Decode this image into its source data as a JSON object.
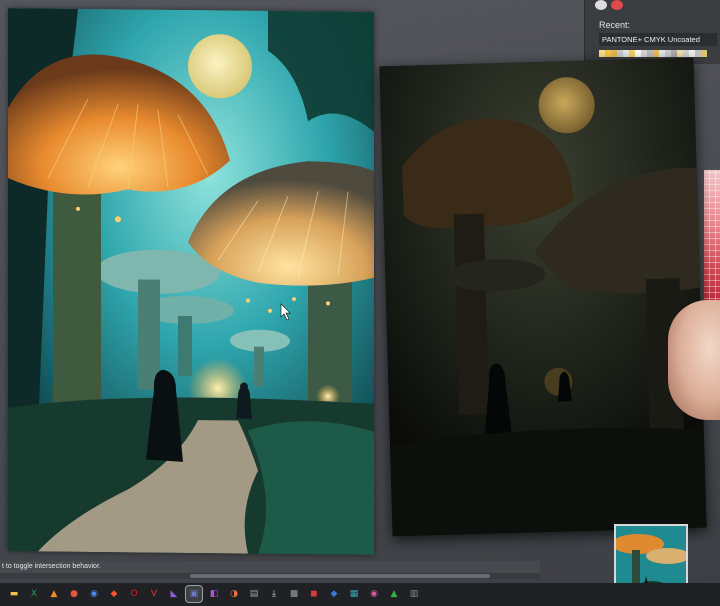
{
  "swatch_panel": {
    "recent_label": "Recent:",
    "library_name": "PANTONE+ CMYK Uncoated",
    "recent_swatches": [
      "#f7e08a",
      "#f2c94c",
      "#e9b949",
      "#c8c8c8",
      "#e6e6e6",
      "#f4d35e",
      "#ffffff",
      "#d9d9d9",
      "#bfbfbf",
      "#f0c05a",
      "#e9e9e9",
      "#cfcfcf",
      "#b0b0b0",
      "#f5e6a8",
      "#d4d4d4",
      "#efefef",
      "#c2c2c2",
      "#e0c36a"
    ]
  },
  "status_bar": {
    "text": "t to toggle intersection behavior."
  },
  "taskbar": {
    "icons": [
      {
        "name": "file-explorer-icon",
        "glyph": "▬",
        "color": "#f2c14e"
      },
      {
        "name": "excel-icon",
        "glyph": "X",
        "color": "#1f9d55"
      },
      {
        "name": "vlc-icon",
        "glyph": "▲",
        "color": "#f28c28"
      },
      {
        "name": "firefox-icon",
        "glyph": "●",
        "color": "#e8553e"
      },
      {
        "name": "chrome-icon",
        "glyph": "◉",
        "color": "#4a8cf0"
      },
      {
        "name": "brave-icon",
        "glyph": "◆",
        "color": "#f2542d"
      },
      {
        "name": "opera-icon",
        "glyph": "O",
        "color": "#e02020"
      },
      {
        "name": "vivaldi-icon",
        "glyph": "V",
        "color": "#d93a3a"
      },
      {
        "name": "visual-studio-icon",
        "glyph": "◣",
        "color": "#8a5cd6"
      },
      {
        "name": "app-window-icon",
        "glyph": "▣",
        "color": "#6c7ad6",
        "active": true
      },
      {
        "name": "app-purple-icon",
        "glyph": "◧",
        "color": "#a05ad6"
      },
      {
        "name": "app-orange-icon",
        "glyph": "◑",
        "color": "#e8783a"
      },
      {
        "name": "app-gray-icon",
        "glyph": "▤",
        "color": "#9aa0a6"
      },
      {
        "name": "upload-icon",
        "glyph": "⤓",
        "color": "#d0d0d0"
      },
      {
        "name": "app-dark-icon",
        "glyph": "■",
        "color": "#777777"
      },
      {
        "name": "app-red-icon",
        "glyph": "◼",
        "color": "#d63a3a"
      },
      {
        "name": "app-blue-icon",
        "glyph": "◆",
        "color": "#3a7ad6"
      },
      {
        "name": "app-teal-icon",
        "glyph": "▦",
        "color": "#3aa6b0"
      },
      {
        "name": "app-pink-icon",
        "glyph": "◉",
        "color": "#d65aa0"
      },
      {
        "name": "app-green-icon",
        "glyph": "▲",
        "color": "#3ab04a"
      },
      {
        "name": "app-gray2-icon",
        "glyph": "▥",
        "color": "#8a8a8a"
      }
    ]
  },
  "colors": {
    "workspace": "#4e4f55",
    "sky": "#2aa0a8",
    "moon": "#f2e9a8",
    "glow": "#f5a030"
  }
}
